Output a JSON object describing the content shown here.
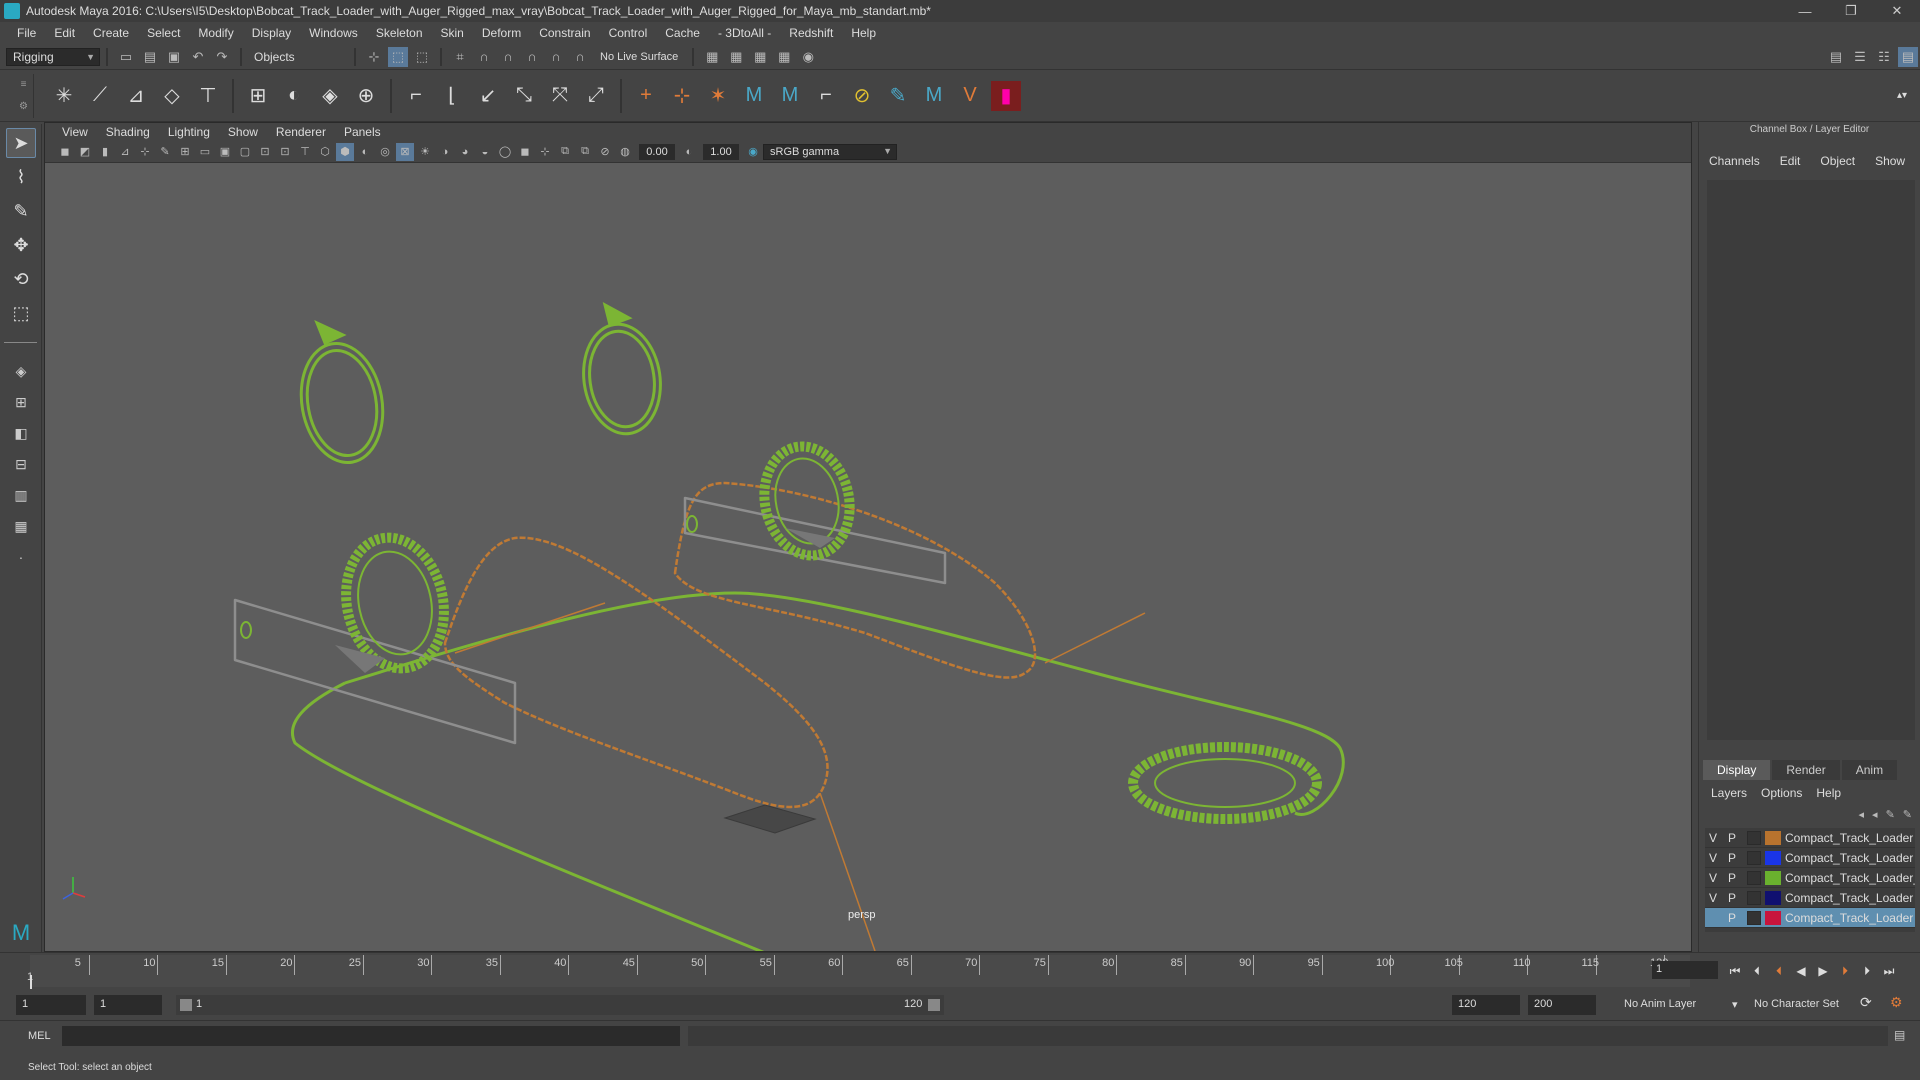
{
  "window": {
    "title": "Autodesk Maya 2016: C:\\Users\\I5\\Desktop\\Bobcat_Track_Loader_with_Auger_Rigged_max_vray\\Bobcat_Track_Loader_with_Auger_Rigged_for_Maya_mb_standart.mb*",
    "minimize": "—",
    "maximize": "❐",
    "close": "✕"
  },
  "menubar": [
    "File",
    "Edit",
    "Create",
    "Select",
    "Modify",
    "Display",
    "Windows",
    "Skeleton",
    "Skin",
    "Deform",
    "Constrain",
    "Control",
    "Cache",
    "- 3DtoAll -",
    "Redshift",
    "Help"
  ],
  "statusline": {
    "menuset": "Rigging",
    "selection_mode": "Objects",
    "live_surface": "No Live Surface"
  },
  "panel": {
    "menus": [
      "View",
      "Shading",
      "Lighting",
      "Show",
      "Renderer",
      "Panels"
    ],
    "exposure": "0.00",
    "gamma": "1.00",
    "color_space": "sRGB gamma",
    "camera": "persp"
  },
  "channel_box": {
    "title": "Channel Box / Layer Editor",
    "menus": [
      "Channels",
      "Edit",
      "Object",
      "Show"
    ]
  },
  "layer_editor": {
    "tabs": [
      "Display",
      "Render",
      "Anim"
    ],
    "active_tab": "Display",
    "menus": [
      "Layers",
      "Options",
      "Help"
    ],
    "layers": [
      {
        "v": "V",
        "p": "P",
        "color": "#b8732e",
        "name": "Compact_Track_Loader"
      },
      {
        "v": "V",
        "p": "P",
        "color": "#1a35e6",
        "name": "Compact_Track_Loader"
      },
      {
        "v": "V",
        "p": "P",
        "color": "#6ab12e",
        "name": "Compact_Track_Loader_"
      },
      {
        "v": "V",
        "p": "P",
        "color": "#101070",
        "name": "Compact_Track_Loader"
      },
      {
        "v": "",
        "p": "P",
        "color": "#c8143c",
        "name": "Compact_Track_Loader"
      }
    ]
  },
  "timeline": {
    "ticks": [
      5,
      10,
      15,
      20,
      25,
      30,
      35,
      40,
      45,
      50,
      55,
      60,
      65,
      70,
      75,
      80,
      85,
      90,
      95,
      100,
      105,
      110,
      115,
      120
    ],
    "start_label": "1",
    "current_frame": "1"
  },
  "range": {
    "start": "1",
    "playback_start": "1",
    "bar_start": "1",
    "bar_end": "120",
    "playback_end": "120",
    "end": "200",
    "anim_layer": "No Anim Layer",
    "character_set": "No Character Set"
  },
  "command_line": {
    "language": "MEL"
  },
  "help_line": "Select Tool: select an object",
  "colors": {
    "curve_green": "#7cb534",
    "curve_orange": "#c07a34",
    "gray_outline": "#8e8e8e",
    "viewport_bg": "#5d5d5d"
  }
}
